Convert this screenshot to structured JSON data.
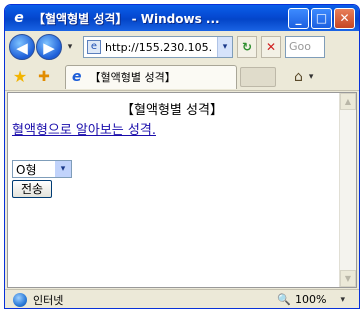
{
  "window": {
    "title": "【혈액형별 성격】 - Windows ...",
    "minimize_glyph": "_",
    "maximize_glyph": "□",
    "close_glyph": "✕"
  },
  "nav": {
    "back_glyph": "◀",
    "forward_glyph": "▶",
    "dropdown_glyph": "▾",
    "address": "http://155.230.105.",
    "refresh_glyph": "↻",
    "stop_glyph": "✕",
    "search_placeholder": "Goo"
  },
  "favorites": {
    "star_glyph": "★",
    "add_glyph": "✚",
    "tab_label": "【혈액형별 성격】",
    "home_glyph": "⌂",
    "home_drop_glyph": "▾"
  },
  "page": {
    "title": "【혈액형별 성격】",
    "link_text": "혈액형으로 알아보는 성격.",
    "select_value": "O형",
    "select_arrow": "▾",
    "submit_label": "전송"
  },
  "scroll": {
    "up_glyph": "▲",
    "down_glyph": "▼"
  },
  "status": {
    "zone": "인터넷",
    "zoom_icon": "🔍",
    "zoom": "100%",
    "zoom_drop": "▾"
  },
  "colors": {
    "titlebar": "#0549d2",
    "link": "#1a0dab",
    "chrome": "#ece9d8"
  },
  "icons": {
    "browser": "ie-logo-icon",
    "page": "page-icon",
    "globe": "globe-icon"
  }
}
